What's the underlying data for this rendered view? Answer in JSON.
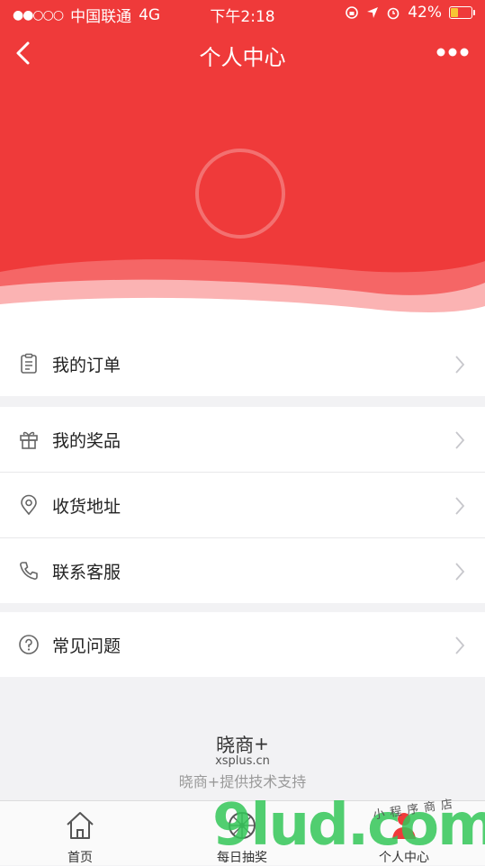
{
  "status_bar": {
    "signal": "●●○○○",
    "carrier": "中国联通",
    "network": "4G",
    "time": "下午2:18",
    "battery": "42%",
    "battery_level": 0.42
  },
  "nav": {
    "title": "个人中心"
  },
  "menu_groups": [
    {
      "items": [
        {
          "icon": "clipboard-icon",
          "label": "我的订单"
        }
      ]
    },
    {
      "items": [
        {
          "icon": "gift-icon",
          "label": "我的奖品"
        },
        {
          "icon": "location-pin-icon",
          "label": "收货地址"
        },
        {
          "icon": "phone-icon",
          "label": "联系客服"
        }
      ]
    },
    {
      "items": [
        {
          "icon": "question-circle-icon",
          "label": "常见问题"
        }
      ]
    }
  ],
  "footer": {
    "logo": "晓商",
    "logo_plus": "+",
    "url": "xsplus.cn",
    "support": "晓商+提供技术支持"
  },
  "tabbar": {
    "items": [
      {
        "icon": "home-icon",
        "label": "首页"
      },
      {
        "icon": "wheel-icon",
        "label": "每日抽奖"
      },
      {
        "icon": "person-icon",
        "label": "个人中心",
        "active": true
      }
    ]
  },
  "watermark": {
    "text": "9lud.com",
    "tagline": "小程序商店"
  },
  "colors": {
    "brand_red": "#ef3a3a",
    "background": "#f2f2f4",
    "watermark_green": "#34c759"
  }
}
